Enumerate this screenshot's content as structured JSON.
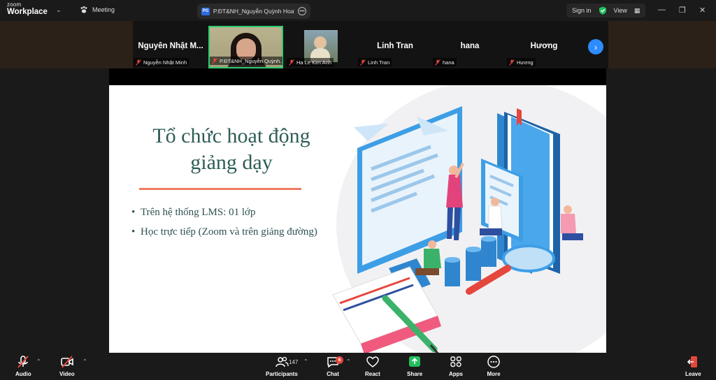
{
  "app": {
    "brand_small": "zoom",
    "brand_large": "Workplace"
  },
  "header": {
    "meeting_label": "Meeting",
    "tab_title": "P.ĐT&NH_Nguyễn Quỳnh Hoa's s",
    "tab_badge": "PG",
    "sign_in": "Sign in",
    "view": "View"
  },
  "participants": [
    {
      "display": "Nguyễn Nhật M...",
      "label": "Nguyễn Nhật Minh",
      "muted": true
    },
    {
      "display": "",
      "label": "P.ĐT&NH_Nguyễn Quỳnh...",
      "muted": true,
      "video": true,
      "active": true
    },
    {
      "display": "",
      "label": "Ha Le Kim Anh",
      "muted": true,
      "photo": true
    },
    {
      "display": "Linh Tran",
      "label": "Linh Tran",
      "muted": true
    },
    {
      "display": "hana",
      "label": "hana",
      "muted": true
    },
    {
      "display": "Hương",
      "label": "Hương",
      "muted": true
    }
  ],
  "slide": {
    "title_line1": "Tổ chức hoạt động",
    "title_line2": "giảng dạy",
    "bullets": [
      "Trên hệ thống LMS: 01 lớp",
      "Học trực tiếp (Zoom và trên giảng đường)"
    ]
  },
  "toolbar": {
    "audio": "Audio",
    "video": "Video",
    "participants": "Participants",
    "participants_count": "147",
    "chat": "Chat",
    "chat_badge": "6",
    "react": "React",
    "share": "Share",
    "apps": "Apps",
    "more": "More",
    "leave": "Leave"
  },
  "colors": {
    "share_green": "#20c05c",
    "active_border": "#2ecc71",
    "accent_blue": "#2d8cff",
    "leave_red": "#e5473d"
  }
}
